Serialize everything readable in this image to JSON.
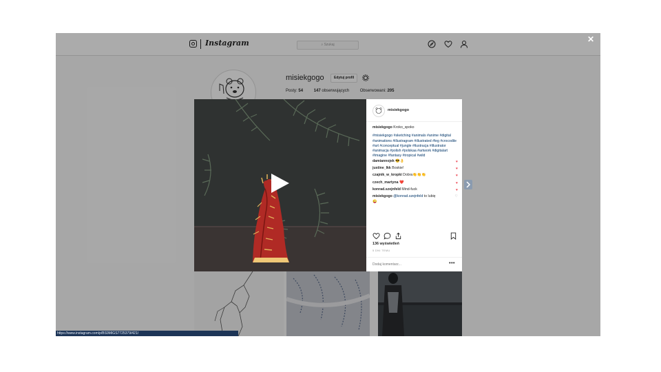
{
  "nav": {
    "logo_text": "Instagram",
    "search_placeholder": "Szukaj"
  },
  "profile": {
    "username": "misiekgogo",
    "edit_label": "Edytuj profil",
    "stats": [
      {
        "label": "Posty:",
        "value": "54"
      },
      {
        "label": "obserwujących",
        "value": "147"
      },
      {
        "label": "Obserwowani:",
        "value": "205"
      }
    ]
  },
  "post": {
    "username": "misiekgogo",
    "caption_text": "Kroko_spoko",
    "hashtags": "#misiekgogo #sketching #animals #anime #digital #animations #illustragram #illustrated #leg #crocodile #art #conceptual #jungle #ilustracja #illustrator #animacja #polish #polskaa #artwork #digitalart #imagine #fantasy #tropical #wild",
    "comments": [
      {
        "user": "damiannojek",
        "text": "😎👌",
        "liked": true
      },
      {
        "user": "justine_lkk",
        "text": "Boskie!",
        "liked": true
      },
      {
        "user": "czajnik_w_kropki",
        "text": "Dobra👏👏👏",
        "liked": true
      },
      {
        "user": "czech_martyna",
        "text": "❤️",
        "liked": true
      },
      {
        "user": "konrad.szejnfeld",
        "text": "Mind-fuck",
        "liked": true
      }
    ],
    "reply": {
      "user": "misiekgogo",
      "mention": "@konrad.szejnfeld",
      "text": "to lubię",
      "emoji": "😜"
    },
    "views": "136 wyświetleń",
    "time": "5 DNI TEMU",
    "comment_placeholder": "Dodaj komentarz...",
    "more_label": "•••"
  },
  "close_label": "✕",
  "status_url": "https://www.instagram.com/p/BS9MIGS7725379/421/",
  "colors": {
    "link": "#003569",
    "heart": "#ed4956",
    "status_bg": "#1d3557"
  }
}
